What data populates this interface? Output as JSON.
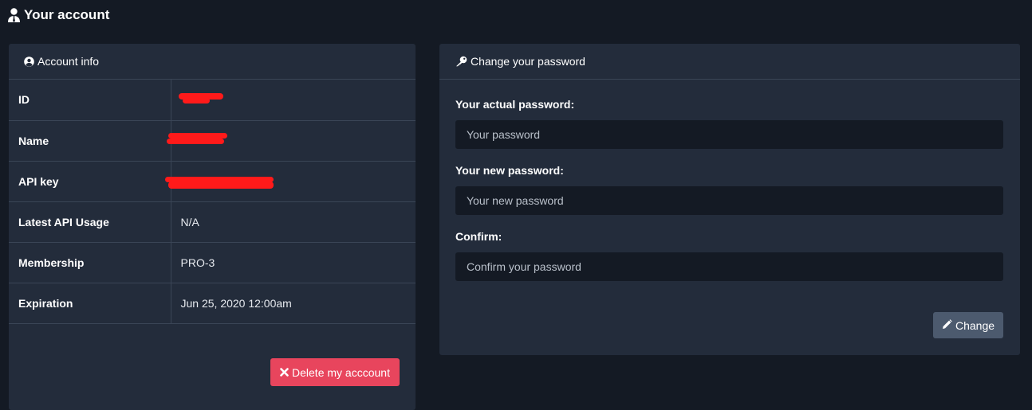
{
  "page": {
    "title": "Your account",
    "title_icon": "user-tie-icon"
  },
  "account_info": {
    "header": "Account info",
    "header_icon": "user-circle-icon",
    "rows": [
      {
        "key": "ID",
        "value": ""
      },
      {
        "key": "Name",
        "value": ""
      },
      {
        "key": "API key",
        "value": ""
      },
      {
        "key": "Latest API Usage",
        "value": "N/A"
      },
      {
        "key": "Membership",
        "value": "PRO-3"
      },
      {
        "key": "Expiration",
        "value": "Jun 25, 2020 12:00am"
      }
    ],
    "delete_button": {
      "label": "Delete my acccount",
      "icon": "times-icon",
      "color": "#e8455d"
    }
  },
  "change_password": {
    "header": "Change your password",
    "header_icon": "key-icon",
    "fields": [
      {
        "label": "Your actual password:",
        "placeholder": "Your password",
        "value": ""
      },
      {
        "label": "Your new password:",
        "placeholder": "Your new password",
        "value": ""
      },
      {
        "label": "Confirm:",
        "placeholder": "Confirm your password",
        "value": ""
      }
    ],
    "submit_button": {
      "label": "Change",
      "icon": "pencil-icon"
    }
  },
  "colors": {
    "background": "#141a24",
    "card": "#232c3b",
    "danger": "#e8455d",
    "secondary_button": "#4c5a6e",
    "redaction": "#ff1a1a"
  }
}
